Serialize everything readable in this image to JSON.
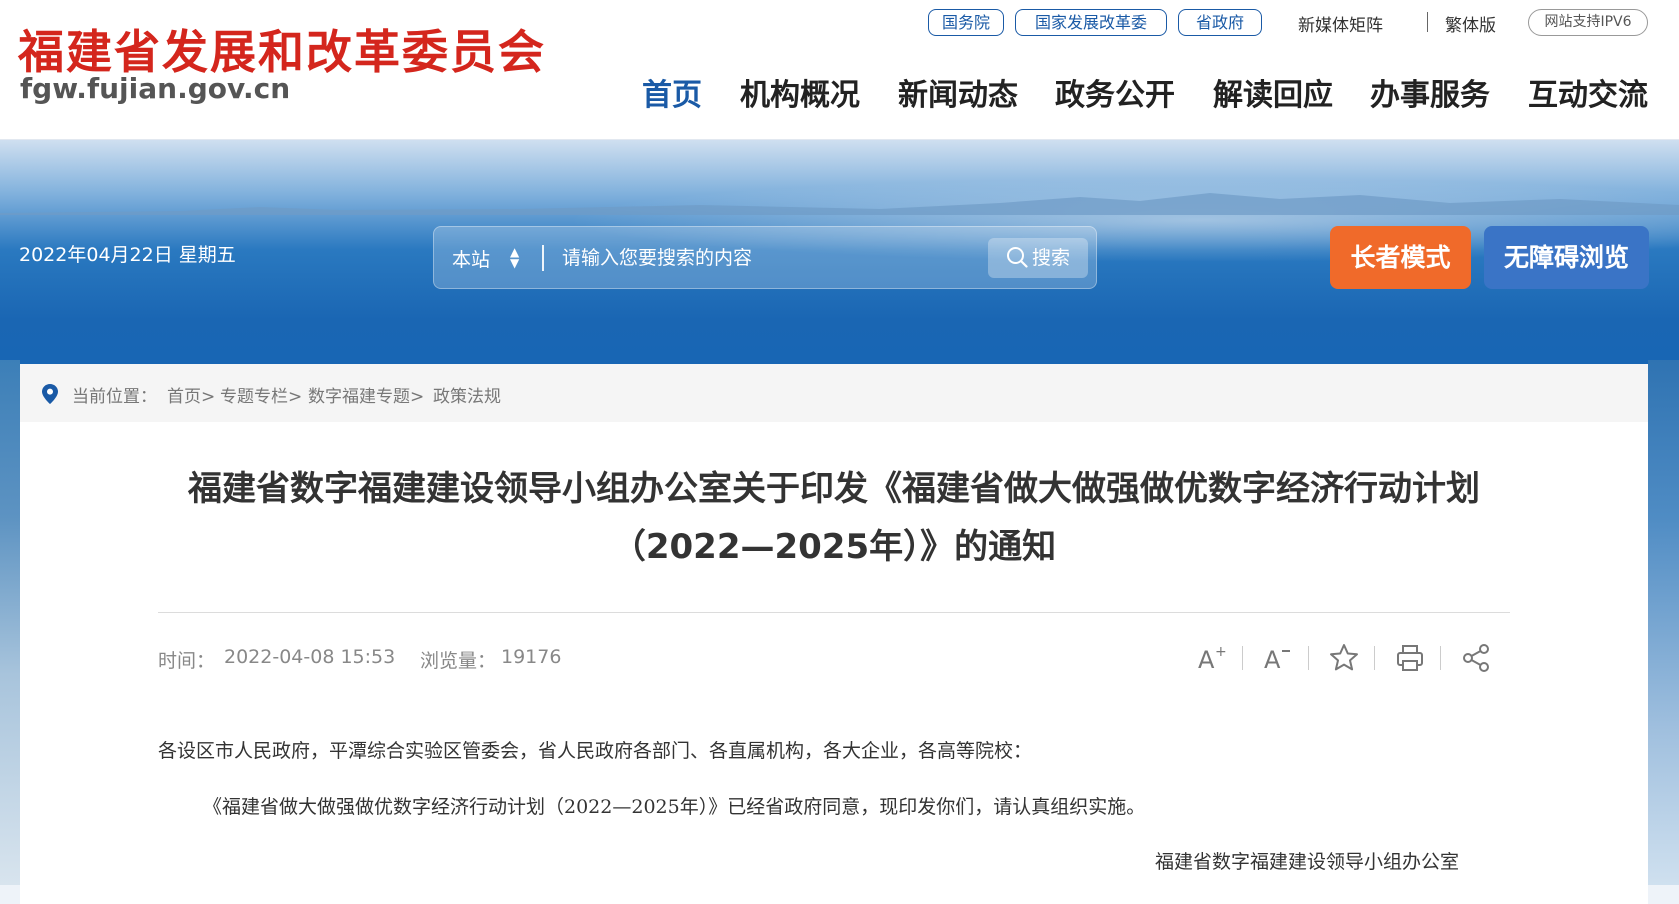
{
  "header": {
    "site_title": "福建省发展和改革委员会",
    "site_domain": "fgw.fujian.gov.cn",
    "external_links": [
      "国务院",
      "国家发展改革委",
      "省政府"
    ],
    "new_media": "新媒体矩阵",
    "traditional": "繁体版",
    "ipv6": "网站支持IPV6",
    "nav": [
      "首页",
      "机构概况",
      "新闻动态",
      "政务公开",
      "解读回应",
      "办事服务",
      "互动交流"
    ],
    "active_nav": "首页"
  },
  "banner": {
    "date": "2022年04月22日 星期五",
    "search_scope": "本站",
    "search_placeholder": "请输入您要搜索的内容",
    "search_button": "搜索",
    "elder_mode": "长者模式",
    "accessibility": "无障碍浏览"
  },
  "breadcrumb": {
    "label": "当前位置：",
    "items": [
      "首页>",
      "专题专栏>",
      "数字福建专题>",
      "政策法规"
    ]
  },
  "article": {
    "title_line1": "福建省数字福建建设领导小组办公室关于印发《福建省做大做强做优数字经济行动计划",
    "title_line2": "（2022—2025年）》的通知",
    "time_label": "时间：",
    "time": "2022-04-08 15:53",
    "views_label": "浏览量：",
    "views": "19176",
    "tools": [
      "font-increase-icon",
      "font-decrease-icon",
      "favorite-star-icon",
      "print-icon",
      "share-icon"
    ],
    "paragraphs": [
      "各设区市人民政府，平潭综合实验区管委会，省人民政府各部门、各直属机构，各大企业，各高等院校：",
      "《福建省做大做强做优数字经济行动计划（2022—2025年）》已经省政府同意，现印发你们，请认真组织实施。",
      "福建省数字福建建设领导小组办公室"
    ]
  },
  "colors": {
    "brand_red": "#d4261d",
    "nav_blue": "#1a5aa6",
    "elder_orange": "#f06a2a",
    "a11y_blue": "#3a74c6"
  }
}
